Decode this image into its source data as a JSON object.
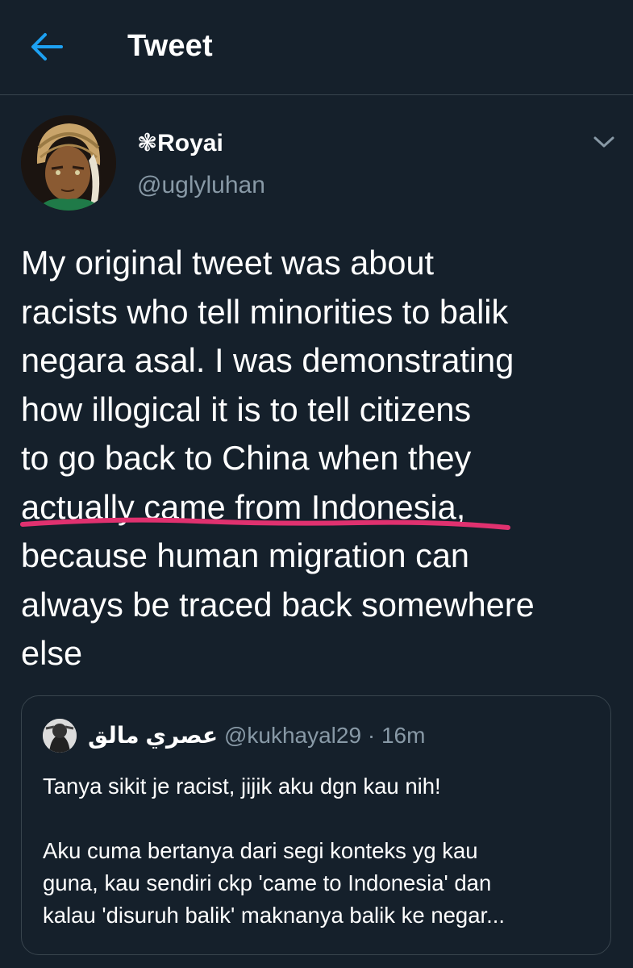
{
  "header": {
    "title": "Tweet"
  },
  "tweet": {
    "display_name": "❃Royai",
    "handle": "@uglyluhan",
    "text": "My original tweet was about\nracists who tell minorities to balik\nnegara asal. I was demonstrating\nhow illogical it is to tell citizens\nto go back to China when they\nactually came from Indonesia,\nbecause human migration can\nalways be traced back somewhere\nelse"
  },
  "quoted_tweet": {
    "display_name": "عصري مالق",
    "handle": "@kukhayal29",
    "separator": "·",
    "time": "16m",
    "text": "Tanya sikit je racist, jijik aku dgn kau nih!\n\nAku cuma bertanya dari segi konteks yg kau\nguna, kau sendiri ckp 'came to Indonesia' dan\nkalau 'disuruh balik' maknanya balik ke negar..."
  },
  "colors": {
    "background": "#15202b",
    "accent": "#1da1f2",
    "secondary_text": "#8899a6",
    "border": "#38444d",
    "annotation": "#e0316f"
  },
  "icons": {
    "back": "arrow-left-icon",
    "more": "chevron-down-icon"
  }
}
